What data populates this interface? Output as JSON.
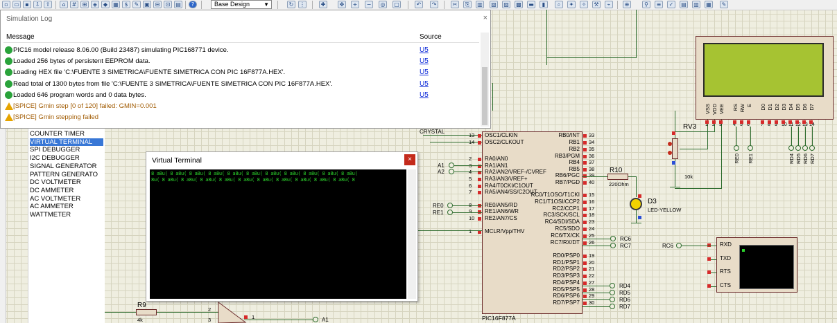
{
  "toolbar": {
    "design_select": "Base Design"
  },
  "instrument_list": {
    "items": [
      "COUNTER TIMER",
      "VIRTUAL TERMINAL",
      "SPI DEBUGGER",
      "I2C DEBUGGER",
      "SIGNAL GENERATOR",
      "PATTERN GENERATO",
      "DC VOLTMETER",
      "DC AMMETER",
      "AC VOLTMETER",
      "AC AMMETER",
      "WATTMETER"
    ],
    "selected": "VIRTUAL TERMINAL"
  },
  "sim_log": {
    "title": "Simulation Log",
    "col_message": "Message",
    "col_source": "Source",
    "rows": [
      {
        "type": "info",
        "message": "PIC16 model release 8.06.00 (Build 23487) simulating PIC168771 device.",
        "source": "U5"
      },
      {
        "type": "info",
        "message": "Loaded 256 bytes of persistent EEPROM data.",
        "source": "U5"
      },
      {
        "type": "info",
        "message": "Loading HEX file 'C:\\FUENTE 3 SIMETRICA\\FUENTE SIMETRICA CON PIC 16F877A.HEX'.",
        "source": "U5"
      },
      {
        "type": "info",
        "message": "Read total of 1300 bytes from file 'C:\\FUENTE 3 SIMETRICA\\FUENTE SIMETRICA CON PIC 16F877A.HEX'.",
        "source": "U5"
      },
      {
        "type": "info",
        "message": "Loaded 646 program words and 0 data bytes.",
        "source": "U5"
      },
      {
        "type": "warn",
        "message": "[SPICE] Gmin step [0 of 120] failed: GMIN=0.001",
        "source": ""
      },
      {
        "type": "warn",
        "message": "[SPICE] Gmin stepping failed",
        "source": ""
      }
    ],
    "close": "×"
  },
  "virtual_terminal": {
    "title": "Virtual Terminal",
    "close": "×",
    "line1": "8  a8u(  8  a8u(  8  a8u(  8  a8u(  8  a8u(  8  a8u(  8  a8u(  8  a8u(  8  a8u(  8  a8u(  8  a8u(",
    "line2": "8u(  8  a8u(  8  a8u(  8  a8u(  8  a8u(  8  a8u(  8  a8u(  8  a8u(  8  a8u(  8  a8u(  8  a8u(  8"
  },
  "schematic": {
    "crystal_label": "CRYSTAL",
    "pic_name": "PIC16F877A",
    "pic_left_pins": [
      {
        "num": "13",
        "name": "OSC1/CLKIN"
      },
      {
        "num": "14",
        "name": "OSC2/CLKOUT"
      },
      {
        "num": "2",
        "name": "RA0/AN0"
      },
      {
        "num": "3",
        "name": "RA1/AN1"
      },
      {
        "num": "4",
        "name": "RA2/AN2/VREF-/CVREF"
      },
      {
        "num": "5",
        "name": "RA3/AN3/VREF+"
      },
      {
        "num": "6",
        "name": "RA4/T0CKI/C1OUT"
      },
      {
        "num": "7",
        "name": "RA5/AN4/SS/C2OUT"
      },
      {
        "num": "8",
        "name": "RE0/AN5/RD"
      },
      {
        "num": "9",
        "name": "RE1/AN6/WR"
      },
      {
        "num": "10",
        "name": "RE2/AN7/CS"
      },
      {
        "num": "1",
        "name": "MCLR/Vpp/THV"
      }
    ],
    "pic_right_pins": [
      {
        "num": "33",
        "name": "RB0/INT"
      },
      {
        "num": "34",
        "name": "RB1"
      },
      {
        "num": "35",
        "name": "RB2"
      },
      {
        "num": "36",
        "name": "RB3/PGM"
      },
      {
        "num": "37",
        "name": "RB4"
      },
      {
        "num": "38",
        "name": "RB5"
      },
      {
        "num": "39",
        "name": "RB6/PGC"
      },
      {
        "num": "40",
        "name": "RB7/PGD"
      },
      {
        "num": "15",
        "name": "RC0/T1OSO/T1CKI"
      },
      {
        "num": "16",
        "name": "RC1/T1OSI/CCP2"
      },
      {
        "num": "17",
        "name": "RC2/CCP1"
      },
      {
        "num": "18",
        "name": "RC3/SCK/SCL"
      },
      {
        "num": "23",
        "name": "RC4/SDI/SDA"
      },
      {
        "num": "24",
        "name": "RC5/SDO"
      },
      {
        "num": "25",
        "name": "RC6/TX/CK"
      },
      {
        "num": "26",
        "name": "RC7/RX/DT"
      },
      {
        "num": "19",
        "name": "RD0/PSP0"
      },
      {
        "num": "20",
        "name": "RD1/PSP1"
      },
      {
        "num": "21",
        "name": "RD2/PSP2"
      },
      {
        "num": "22",
        "name": "RD3/PSP3"
      },
      {
        "num": "27",
        "name": "RD4/PSP4"
      },
      {
        "num": "28",
        "name": "RD5/PSP5"
      },
      {
        "num": "29",
        "name": "RD6/PSP6"
      },
      {
        "num": "30",
        "name": "RD7/PSP7"
      }
    ],
    "a1": "A1",
    "a2": "A2",
    "re0": "RE0",
    "re1": "RE1",
    "rc6": "RC6",
    "rc7": "RC7",
    "rd4": "RD4",
    "rd5": "RD5",
    "rd6": "RD6",
    "rd7": "RD7",
    "r10": "R10",
    "r10_val": "220Ohm",
    "d3": "D3",
    "d3_val": "LED-YELLOW",
    "rv3": "RV3",
    "rv3_val": "10k",
    "r9": "R9",
    "r9_val": "4k",
    "lcd_pins": [
      "VSS",
      "VDD",
      "VEE",
      "RS",
      "RW",
      "E",
      "D0",
      "D1",
      "D2",
      "D3",
      "D4",
      "D5",
      "D6",
      "D7"
    ],
    "lcd_pin_nums": [
      "1",
      "2",
      "3",
      "4",
      "5",
      "6",
      "7",
      "8",
      "9",
      "10",
      "11",
      "12",
      "13",
      "14"
    ],
    "lcd_nets": [
      "RE0",
      "RE1",
      "RD4",
      "RD5",
      "RD6",
      "RD7"
    ],
    "vt_pins": [
      "RXD",
      "TXD",
      "RTS",
      "CTS"
    ],
    "vt_net": "RC6",
    "op_pin2": "2",
    "op_pin3": "3",
    "op_out_pin": "1",
    "op_out_net": "A1"
  }
}
